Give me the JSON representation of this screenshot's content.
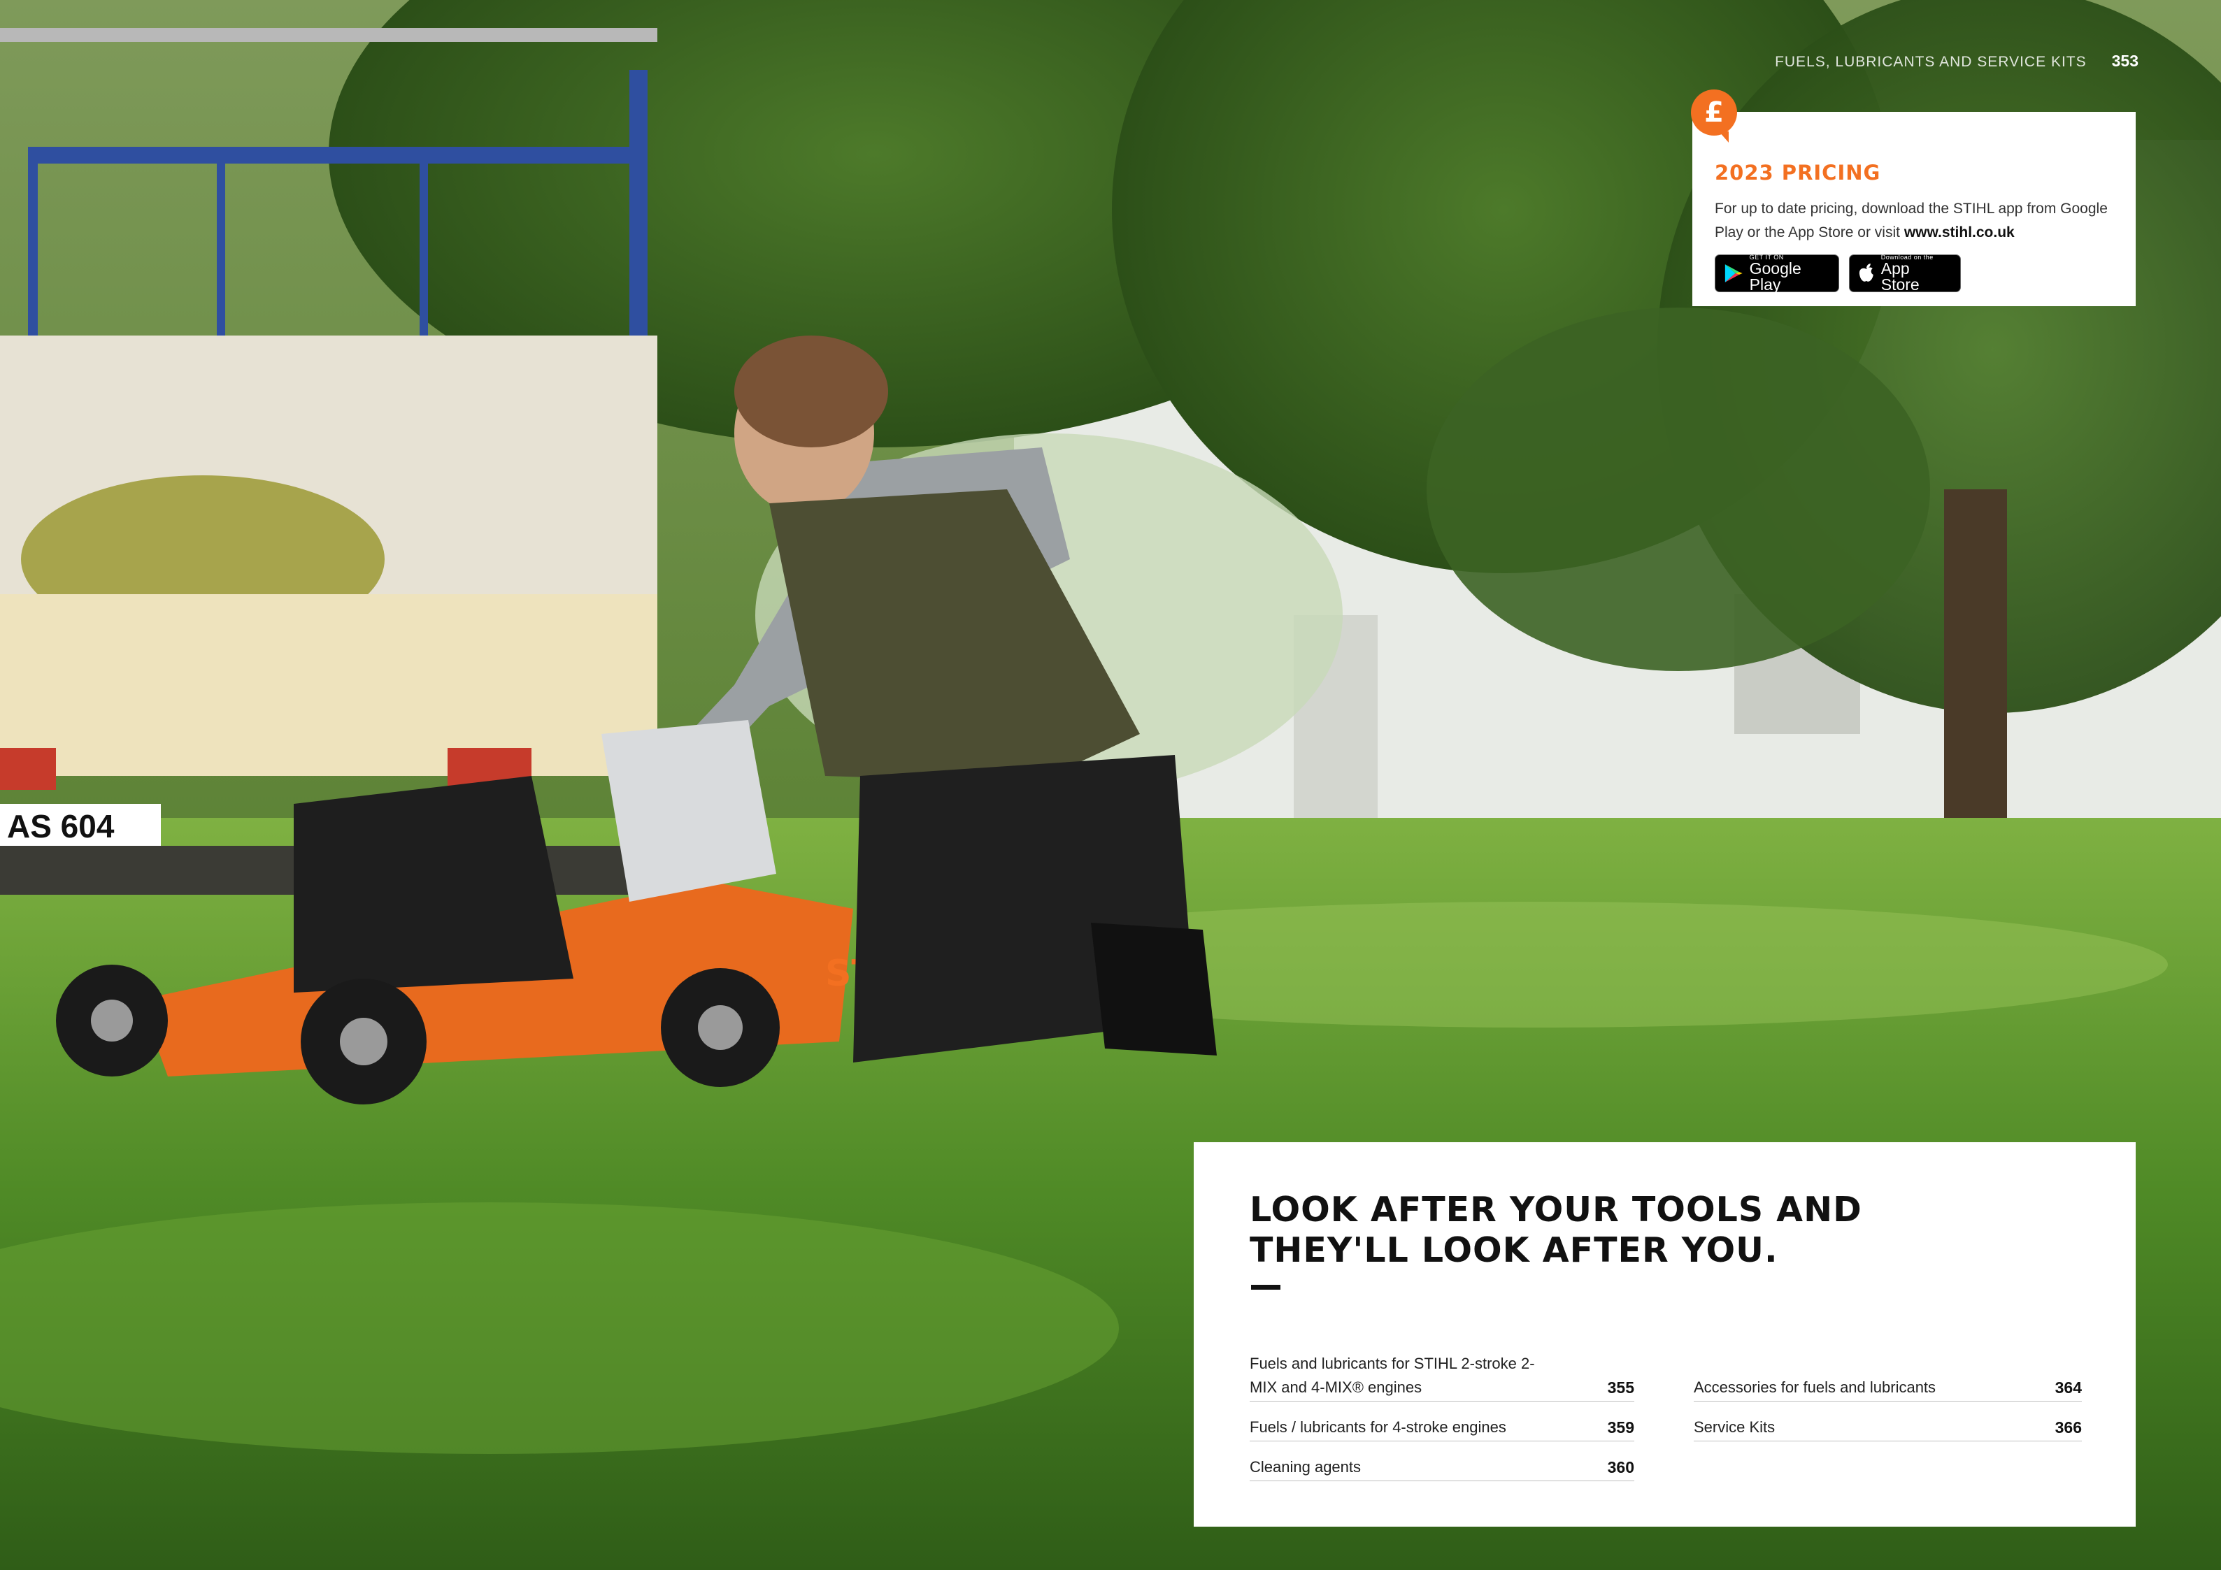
{
  "header": {
    "section": "FUELS, LUBRICANTS AND SERVICE KITS",
    "page_number": "353"
  },
  "pricing": {
    "badge_symbol": "£",
    "title": "2023 PRICING",
    "text": "For up to date pricing, download the STIHL app from Google Play or the App Store or visit",
    "url": "www.stihl.co.uk",
    "google_play": {
      "small": "GET IT ON",
      "big": "Google Play"
    },
    "app_store": {
      "small": "Download on the",
      "big": "App Store"
    }
  },
  "photo": {
    "lettering_mower": "STIHL",
    "lettering_plate": "AS 604"
  },
  "index": {
    "title_line1": "LOOK AFTER YOUR TOOLS AND",
    "title_line2": "THEY'LL LOOK AFTER YOU.",
    "left": [
      {
        "label": "Fuels and lubricants for STIHL 2-stroke 2-MIX and 4-MIX® engines",
        "page": "355"
      },
      {
        "label": "Fuels / lubricants for 4-stroke engines",
        "page": "359"
      },
      {
        "label": "Cleaning agents",
        "page": "360"
      }
    ],
    "right": [
      {
        "label": "Accessories for fuels and lubricants",
        "page": "364"
      },
      {
        "label": "Service Kits",
        "page": "366"
      }
    ]
  },
  "colors": {
    "accent": "#f37021",
    "text": "#111111",
    "card": "#ffffff"
  }
}
